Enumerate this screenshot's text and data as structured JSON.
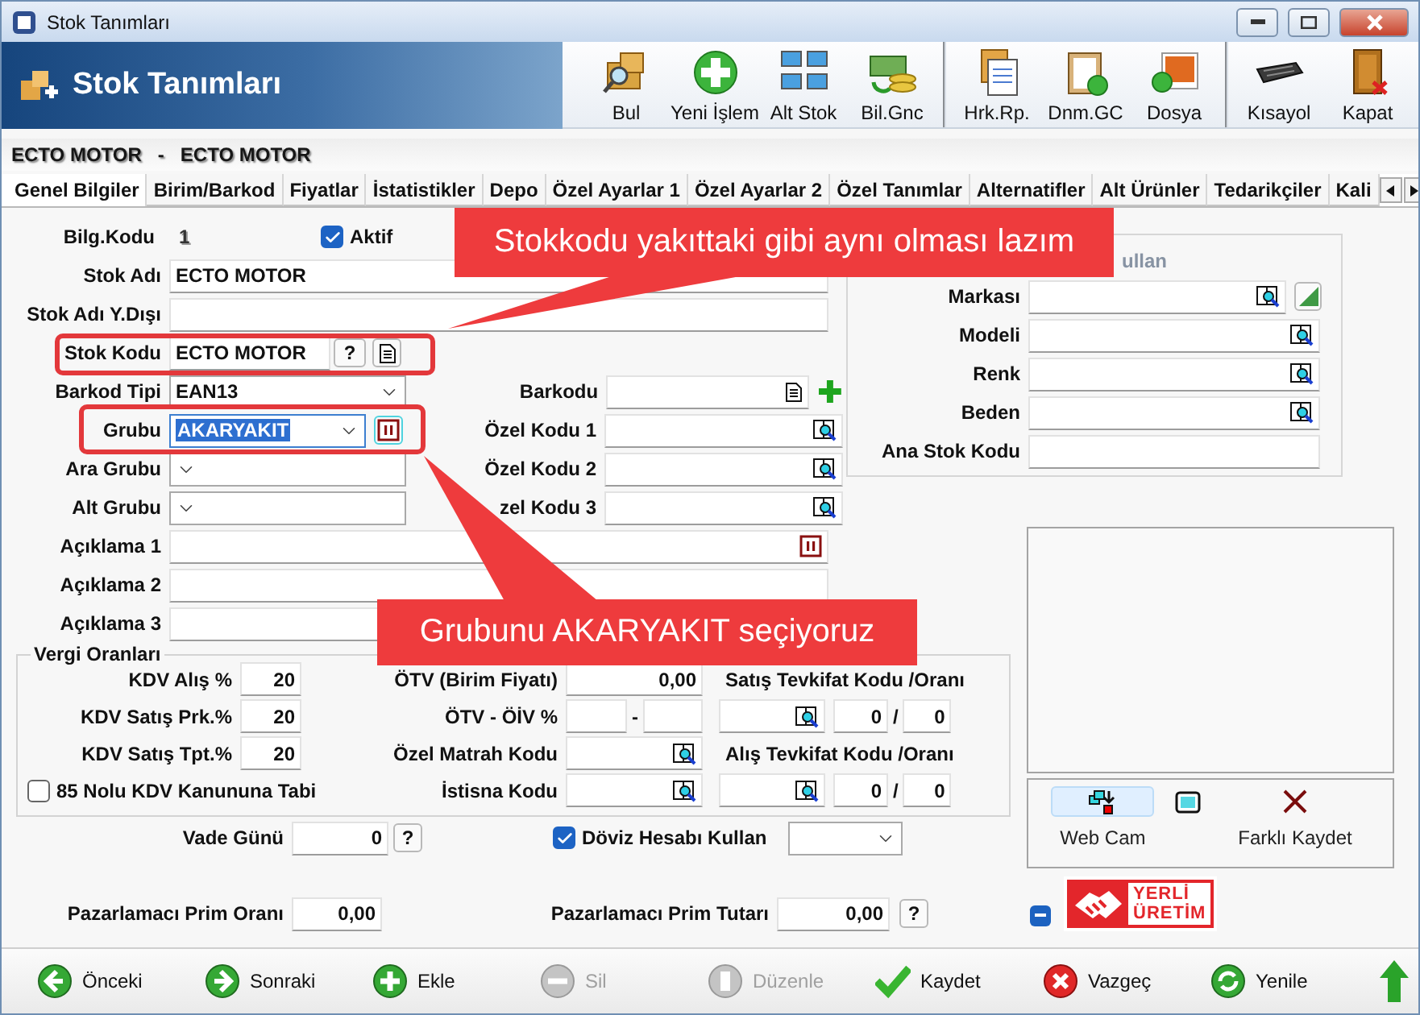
{
  "window": {
    "title": "Stok Tanımları"
  },
  "header": {
    "title": "Stok Tanımları",
    "toolbar_groups": [
      {
        "buttons": [
          {
            "label": "Bul"
          },
          {
            "label": "Yeni İşlem"
          },
          {
            "label": "Alt Stok"
          },
          {
            "label": "Bil.Gnc"
          }
        ]
      },
      {
        "buttons": [
          {
            "label": "Hrk.Rp."
          },
          {
            "label": "Dnm.GC"
          },
          {
            "label": "Dosya"
          }
        ]
      },
      {
        "buttons": [
          {
            "label": "Kısayol"
          },
          {
            "label": "Kapat"
          }
        ]
      }
    ]
  },
  "breadcrumb": {
    "items": [
      "ECTO MOTOR",
      "ECTO MOTOR"
    ],
    "separator": "-"
  },
  "tabs": [
    {
      "label": "Genel Bilgiler",
      "selected": true
    },
    {
      "label": "Birim/Barkod",
      "selected": false
    },
    {
      "label": "Fiyatlar",
      "selected": false
    },
    {
      "label": "İstatistikler",
      "selected": false
    },
    {
      "label": "Depo",
      "selected": false
    },
    {
      "label": "Özel Ayarlar 1",
      "selected": false
    },
    {
      "label": "Özel Ayarlar 2",
      "selected": false
    },
    {
      "label": "Özel Tanımlar",
      "selected": false
    },
    {
      "label": "Alternatifler",
      "selected": false
    },
    {
      "label": "Alt Ürünler",
      "selected": false
    },
    {
      "label": "Tedarikçiler",
      "selected": false
    },
    {
      "label": "Kali",
      "selected": false
    }
  ],
  "form": {
    "bilg_kodu": {
      "label": "Bilg.Kodu",
      "value": "1"
    },
    "aktif": {
      "label": "Aktif",
      "checked": true
    },
    "stok_adi": {
      "label": "Stok Adı",
      "value": "ECTO MOTOR"
    },
    "stok_adi_yd": {
      "label": "Stok Adı Y.Dışı"
    },
    "stok_kodu": {
      "label": "Stok Kodu",
      "value": "ECTO MOTOR",
      "help": "?"
    },
    "barkod_tipi": {
      "label": "Barkod Tipi",
      "value": "EAN13"
    },
    "grubu": {
      "label": "Grubu",
      "value": "AKARYAKIT",
      "text_selected": true
    },
    "ara_grubu": {
      "label": "Ara Grubu"
    },
    "alt_grubu": {
      "label": "Alt Grubu"
    },
    "codes": [
      {
        "label": "Barkodu"
      },
      {
        "label": "Özel Kodu 1"
      },
      {
        "label": "Özel Kodu 2"
      },
      {
        "label": "zel Kodu 3"
      }
    ],
    "aciklama": [
      {
        "label": "Açıklama 1"
      },
      {
        "label": "Açıklama 2"
      },
      {
        "label": "Açıklama 3"
      }
    ]
  },
  "properties": {
    "title": "ullan",
    "fields": [
      {
        "label": "Markası"
      },
      {
        "label": "Modeli"
      },
      {
        "label": "Renk"
      },
      {
        "label": "Beden"
      },
      {
        "label": "Ana Stok Kodu"
      }
    ]
  },
  "tax": {
    "title": "Vergi Oranları",
    "kdv": [
      {
        "label": "KDV Alış %",
        "value": "20"
      },
      {
        "label": "KDV Satış Prk.%",
        "value": "20"
      },
      {
        "label": "KDV Satış Tpt.%",
        "value": "20"
      }
    ],
    "kanun": {
      "label": "85 Nolu KDV Kanununa Tabi",
      "checked": false
    },
    "otv": {
      "label": "ÖTV (Birim Fiyatı)",
      "value": "0,00"
    },
    "otv_oiv": {
      "label": "ÖTV - ÖİV %",
      "separator": "-"
    },
    "ozel_matrah": {
      "label": "Özel Matrah Kodu"
    },
    "istisna": {
      "label": "İstisna Kodu"
    },
    "tevkifat": [
      {
        "label": "Satış Tevkifat Kodu /Oranı",
        "rate1": "0",
        "separator": "/",
        "rate2": "0"
      },
      {
        "label": "Alış Tevkifat Kodu /Oranı",
        "rate1": "0",
        "separator": "/",
        "rate2": "0"
      }
    ]
  },
  "vade": {
    "label": "Vade Günü",
    "value": "0",
    "help": "?"
  },
  "doviz": {
    "label": "Döviz Hesabı Kullan",
    "checked": true
  },
  "prim_orani": {
    "label": "Pazarlamacı Prim Oranı",
    "value": "0,00"
  },
  "prim_tutari": {
    "label": "Pazarlamacı Prim Tutarı",
    "value": "0,00",
    "help": "?"
  },
  "photo": {
    "buttons": [
      {
        "kind": "labeled",
        "label": "Web Cam",
        "hovered": true
      },
      {
        "kind": "icon",
        "hovered": false
      },
      {
        "kind": "labeled",
        "label": "Farklı Kaydet",
        "hovered": false
      }
    ]
  },
  "logo": {
    "line1": "YERLİ",
    "line2": "ÜRETİM"
  },
  "bottom_toolbar": [
    {
      "label": "Önceki",
      "disabled": false
    },
    {
      "label": "Sonraki",
      "disabled": false
    },
    {
      "label": "Ekle",
      "disabled": false
    },
    {
      "label": "Sil",
      "disabled": true
    },
    {
      "label": "Düzenle",
      "disabled": true
    },
    {
      "label": "Kaydet",
      "disabled": false
    },
    {
      "label": "Vazgeç",
      "disabled": false
    },
    {
      "label": "Yenile",
      "disabled": false
    }
  ],
  "callouts": [
    {
      "text": "Stokkodu yakıttaki gibi aynı olması lazım"
    },
    {
      "text": "Grubunu AKARYAKIT seçiyoruz"
    }
  ]
}
